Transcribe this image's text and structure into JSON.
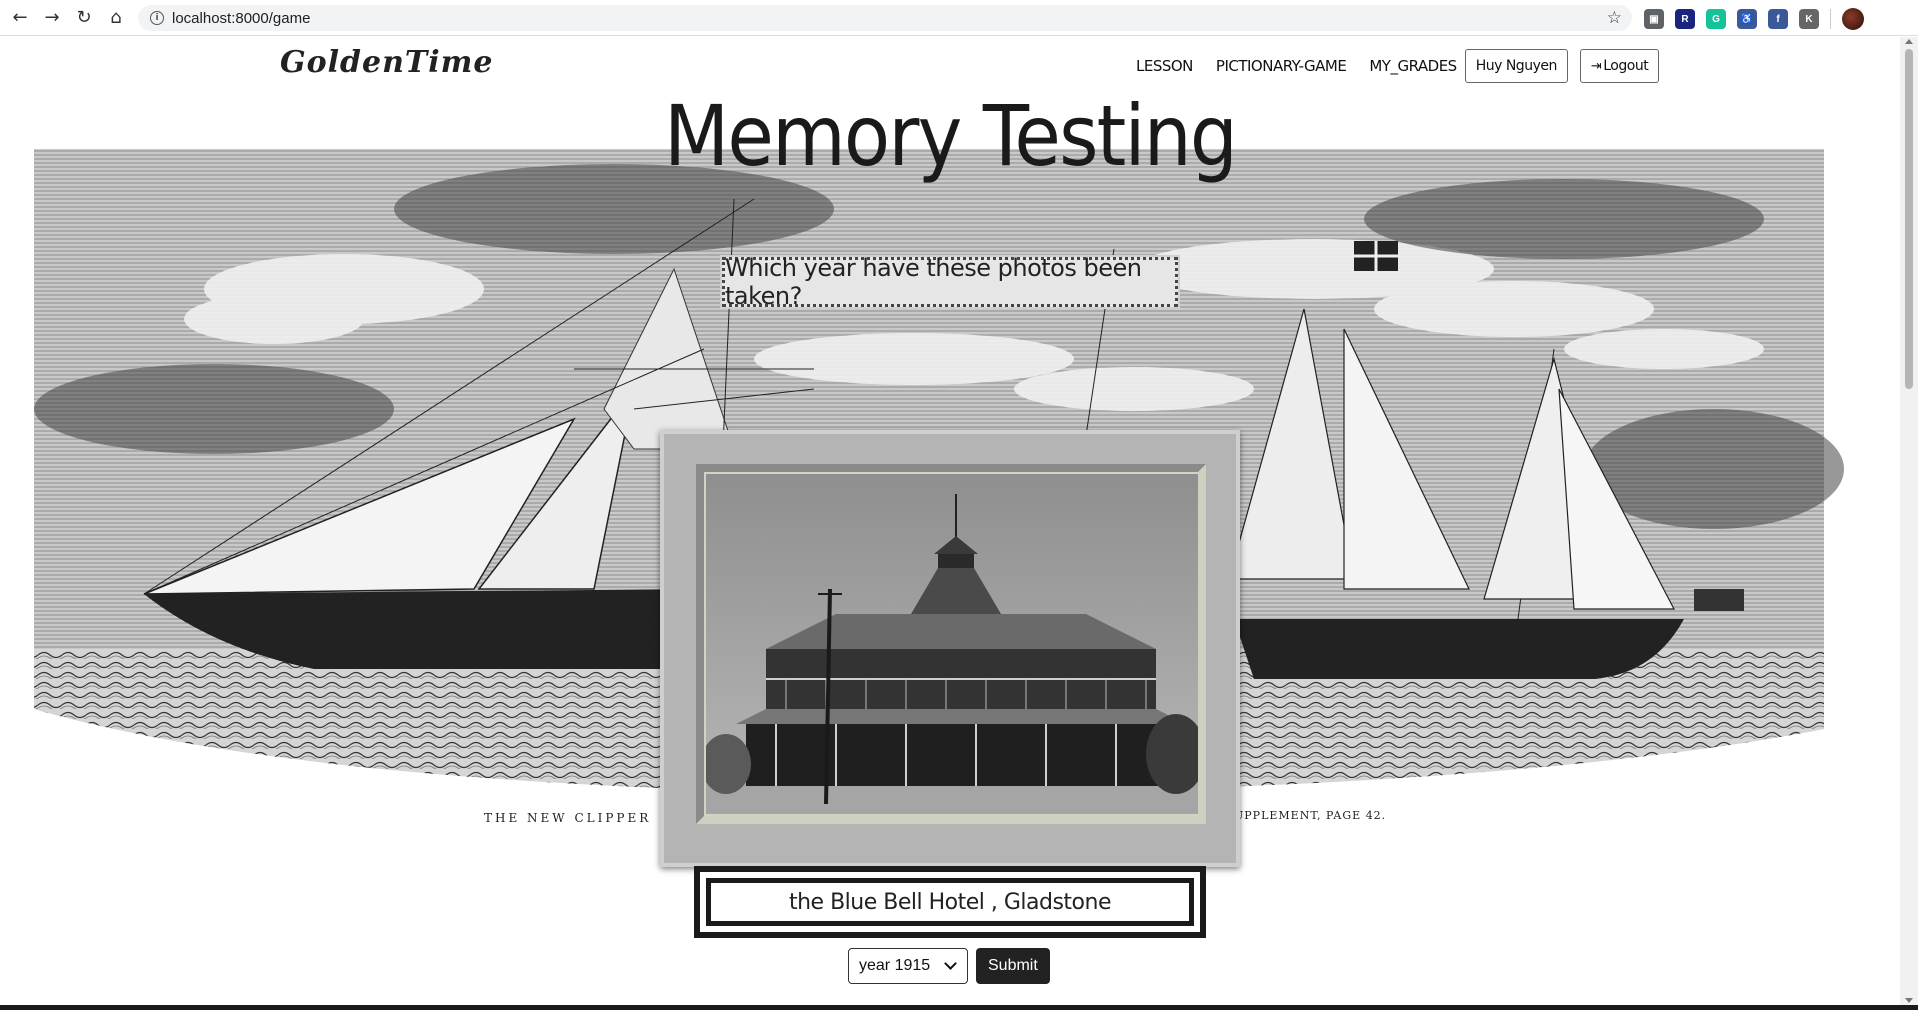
{
  "browser": {
    "url": "localhost:8000/game",
    "back_glyph": "←",
    "forward_glyph": "→",
    "reload_glyph": "↻",
    "home_glyph": "⌂",
    "info_glyph": "i",
    "star_glyph": "☆",
    "extensions": [
      {
        "icon": "cube-extension-icon",
        "color": "#5f6368",
        "glyph": "▣"
      },
      {
        "icon": "r-extension-icon",
        "color": "#1a237e",
        "glyph": "R"
      },
      {
        "icon": "grammarly-icon",
        "color": "#15c39a",
        "glyph": "G"
      },
      {
        "icon": "accessibility-icon",
        "color": "#3b5998",
        "glyph": "♿"
      },
      {
        "icon": "facebook-icon",
        "color": "#3b5998",
        "glyph": "f"
      },
      {
        "icon": "k-extension-icon",
        "color": "#666666",
        "glyph": "K"
      }
    ]
  },
  "nav": {
    "brand": "GoldenTime",
    "lesson": "LESSON",
    "pictionary": "PICTIONARY-GAME",
    "grades": "MY_GRADES",
    "user": "Huy Nguyen",
    "logout_glyph": "⇥",
    "logout": "Logout"
  },
  "hero": {
    "title": "Memory Testing",
    "question": "Which year have these photos been taken?",
    "engraving_caption_left": "THE NEW CLIPPER",
    "engraving_caption_right": "UPPLEMENT, PAGE 42."
  },
  "photo": {
    "caption": "the Blue Bell Hotel , Gladstone"
  },
  "form": {
    "selected_year": "year 1915",
    "submit": "Submit"
  },
  "colors": {
    "dark": "#1a1a1a",
    "frame": "#b4b4b4",
    "question_bg": "#e6e6e6"
  }
}
